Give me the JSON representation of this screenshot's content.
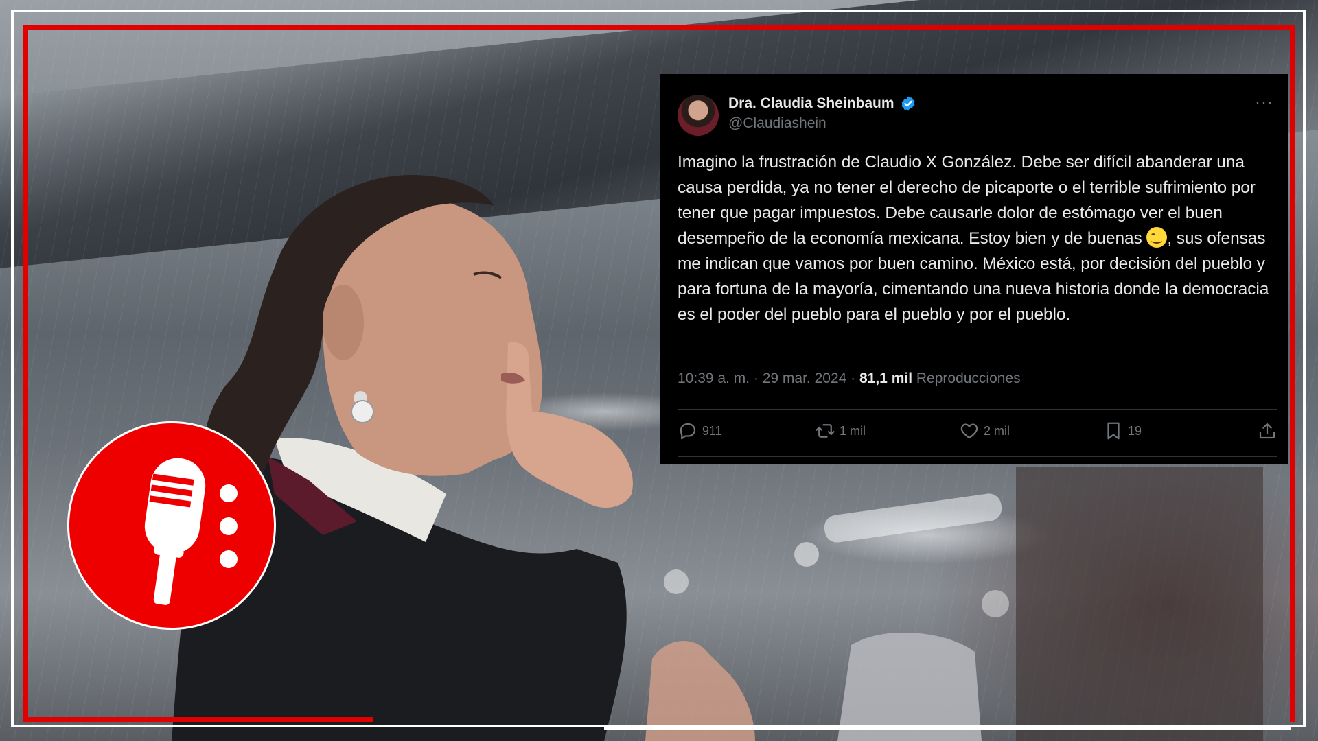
{
  "tweet": {
    "name": "Dra. Claudia Sheinbaum",
    "handle": "@Claudiashein",
    "more": "···",
    "text_part1": "Imagino la frustración de Claudio X González. Debe ser difícil abanderar una causa perdida, ya no tener el derecho de picaporte o el terrible sufrimiento por tener que pagar impuestos. Debe causarle dolor de estómago ver el buen desempeño de la economía mexicana. Estoy bien y de buenas ",
    "text_part2": ", sus ofensas me indican que vamos por buen camino. México está, por decisión del pueblo y para fortuna de la mayoría, cimentando una nueva historia donde la democracia es el poder del pueblo para el pueblo y por el pueblo.",
    "timestamp": "10:39 a. m. · 29 mar. 2024 · ",
    "views_count": "81,1 mil",
    "views_label": " Reproducciones",
    "replies": "911",
    "reposts": "1 mil",
    "likes": "2 mil",
    "bookmarks": "19"
  },
  "icons": {
    "verified": "verified-badge-icon",
    "emoji": "smiling-face-emoji",
    "reply": "reply-icon",
    "repost": "repost-icon",
    "like": "heart-icon",
    "bookmark": "bookmark-icon",
    "share": "share-icon",
    "logo": "microphone-logo-icon"
  },
  "colors": {
    "frame_red": "#e10000",
    "logo_red": "#ee0000",
    "tweet_bg": "#000000",
    "verified_blue": "#1d9bf0",
    "muted_text": "#71767b"
  }
}
